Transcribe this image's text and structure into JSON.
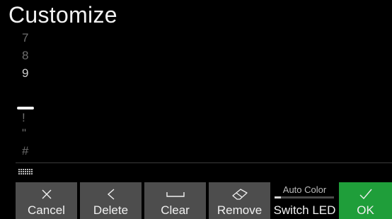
{
  "title": "Customize",
  "characters": {
    "above": [
      "7",
      "8",
      "9"
    ],
    "below": [
      "!",
      "\"",
      "#"
    ]
  },
  "buttons": {
    "cancel": {
      "label": "Cancel",
      "icon": "close-icon"
    },
    "delete": {
      "label": "Delete",
      "icon": "chevron-left-icon"
    },
    "clear": {
      "label": "Clear",
      "icon": "space-bar-icon"
    },
    "remove": {
      "label": "Remove",
      "icon": "eraser-icon"
    },
    "switch_led": {
      "label": "Switch LED",
      "sublabel": "Auto Color"
    },
    "ok": {
      "label": "OK",
      "icon": "check-icon"
    }
  },
  "colors": {
    "background": "#000000",
    "button": "#4d4d4d",
    "ok_button": "#1f9e3a",
    "text": "#f0f0f0",
    "dim_text": "#6e6e6e"
  }
}
